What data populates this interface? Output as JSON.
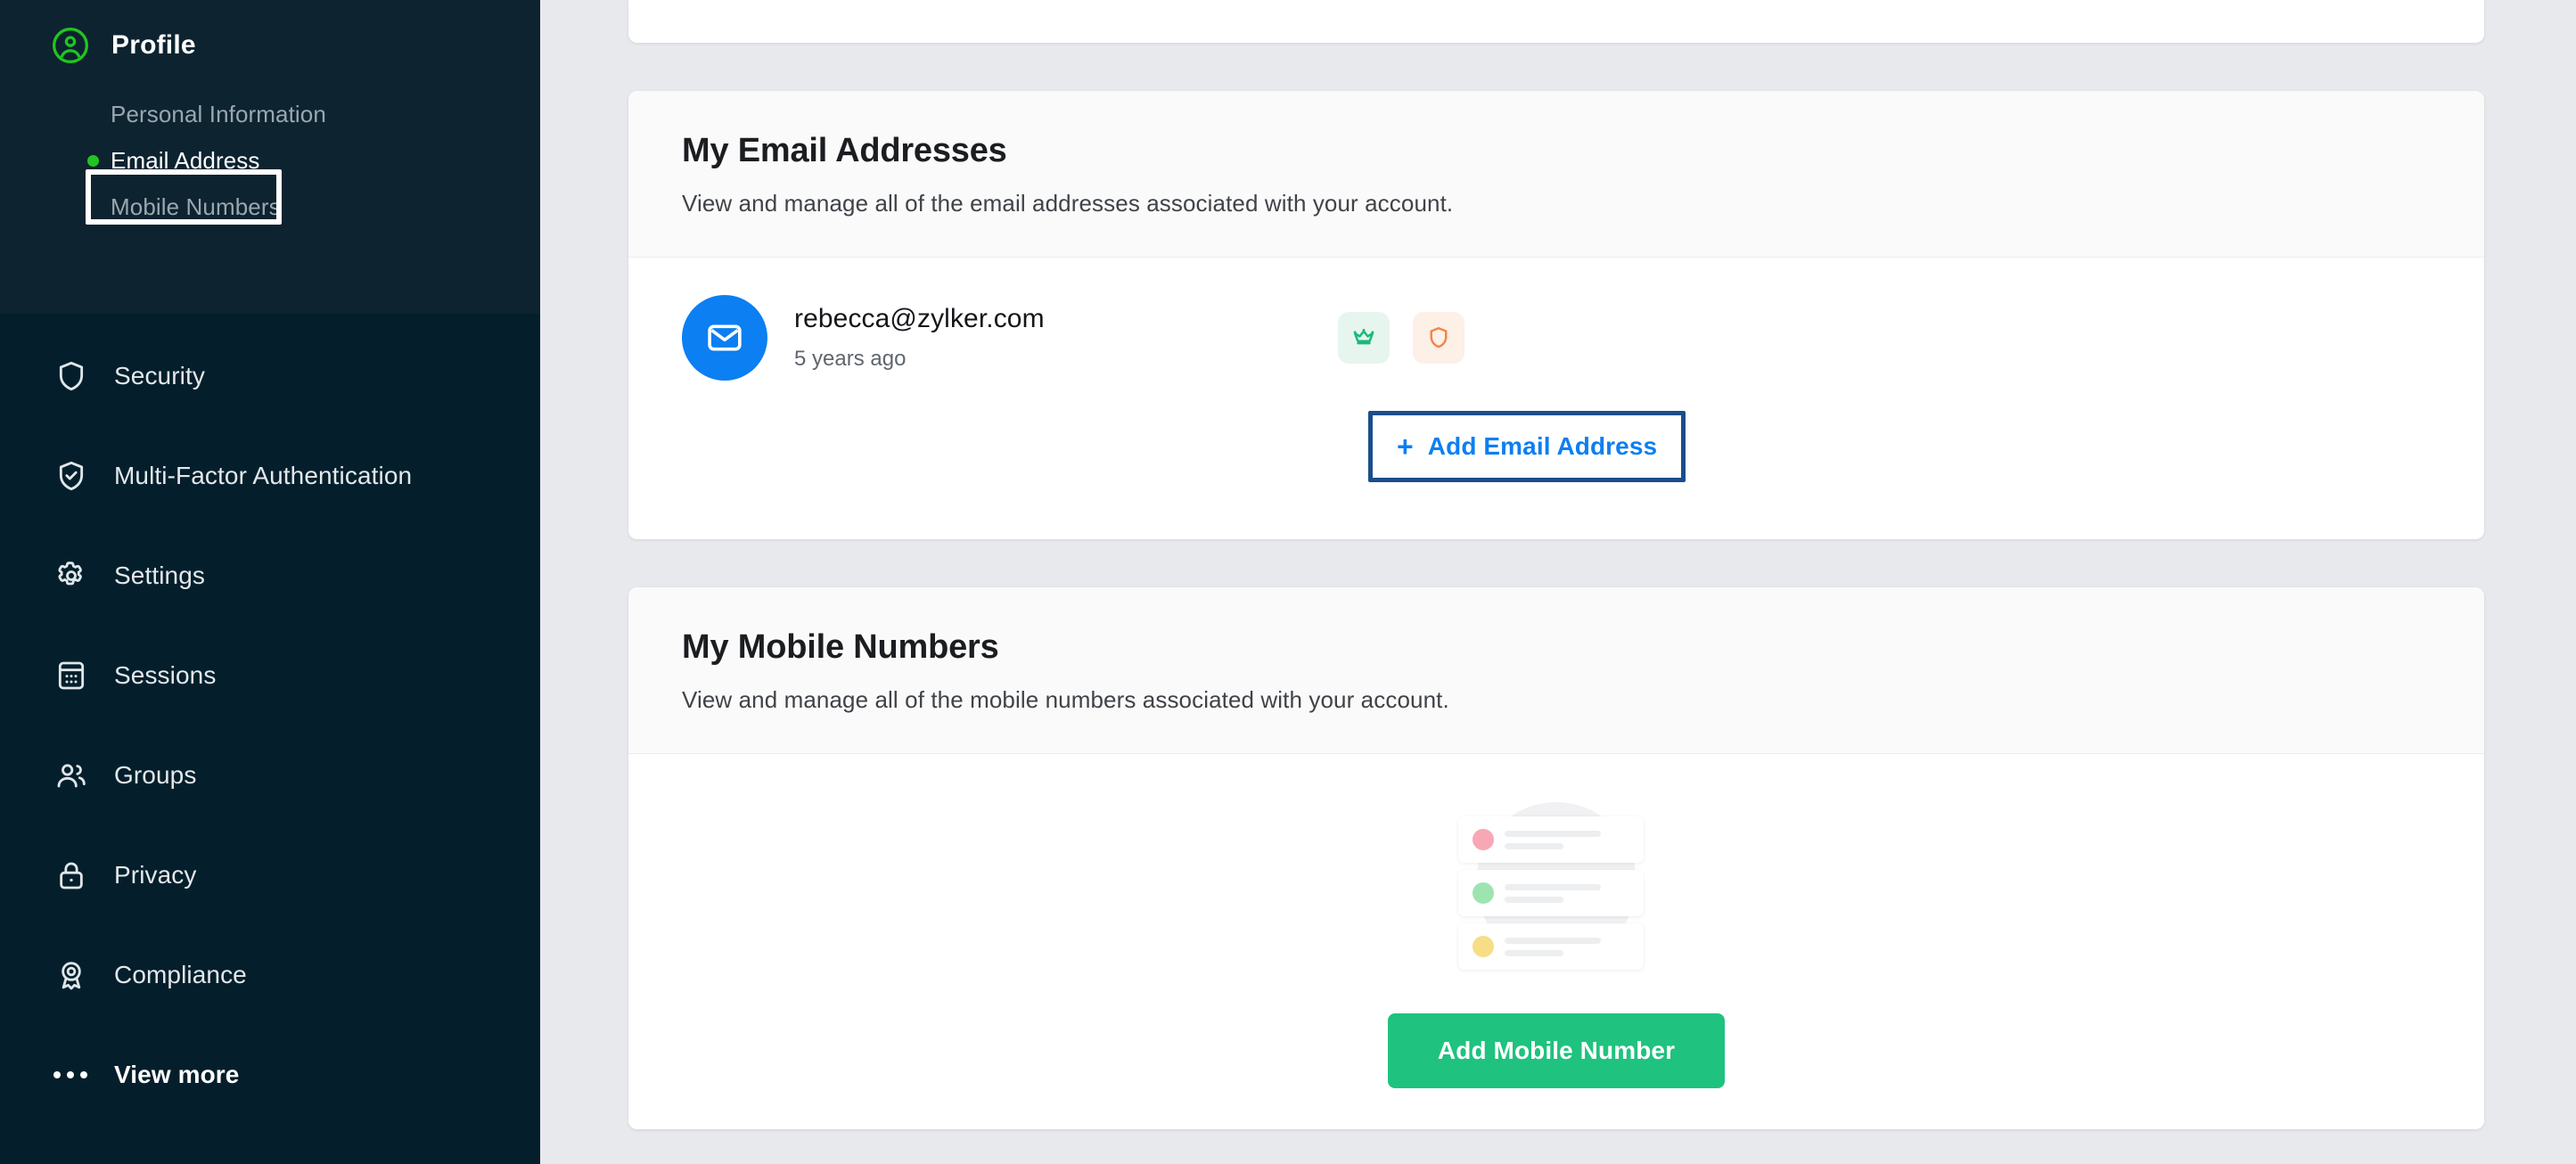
{
  "sidebar": {
    "profile": {
      "label": "Profile",
      "icon": "user-circle-icon",
      "icon_color": "#21c521"
    },
    "sub_items": [
      {
        "label": "Personal Information",
        "active": false
      },
      {
        "label": "Email Address",
        "active": true
      },
      {
        "label": "Mobile Numbers",
        "active": false
      }
    ],
    "nav_items": [
      {
        "label": "Security",
        "icon": "shield-icon"
      },
      {
        "label": "Multi-Factor Authentication",
        "icon": "shield-check-icon"
      },
      {
        "label": "Settings",
        "icon": "gear-icon"
      },
      {
        "label": "Sessions",
        "icon": "sessions-grid-icon"
      },
      {
        "label": "Groups",
        "icon": "users-icon"
      },
      {
        "label": "Privacy",
        "icon": "lock-icon"
      },
      {
        "label": "Compliance",
        "icon": "award-badge-icon"
      },
      {
        "label": "View more",
        "icon": "ellipsis-icon"
      }
    ]
  },
  "email_card": {
    "title": "My Email Addresses",
    "subtitle": "View and manage all of the email addresses associated with your account.",
    "rows": [
      {
        "address": "rebecca@zylker.com",
        "age": "5 years ago",
        "avatar_icon": "envelope-icon",
        "avatar_color": "#0c7ff2",
        "badges": [
          {
            "name": "crown-icon",
            "title": "Primary",
            "color": "#1bb978",
            "bg": "#e6f6ef"
          },
          {
            "name": "shield-icon",
            "title": "Verified",
            "color": "#f58549",
            "bg": "#fdf0e7"
          }
        ]
      }
    ],
    "add_button": {
      "label": "Add Email Address",
      "plus": "+",
      "color": "#0c7ff2",
      "highlight_color": "#1a4e8a"
    }
  },
  "mobile_card": {
    "title": "My Mobile Numbers",
    "subtitle": "View and manage all of the mobile numbers associated with your account.",
    "empty_illustration": {
      "name": "empty-list-illustration",
      "pip_colors": [
        "#f7a8b4",
        "#9ee4b0",
        "#f7dd86"
      ]
    },
    "add_button": {
      "label": "Add Mobile Number",
      "color": "#1fc27e"
    }
  }
}
